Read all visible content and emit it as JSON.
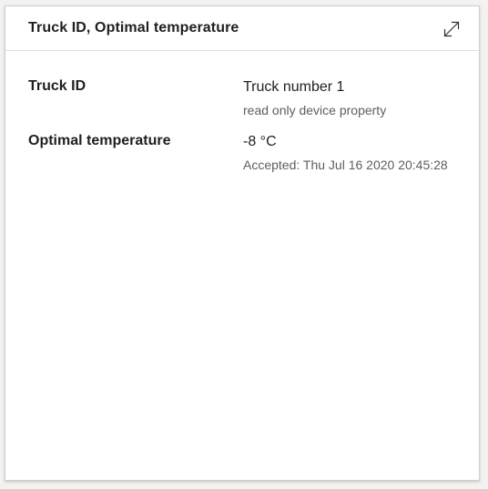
{
  "tile": {
    "title": "Truck ID, Optimal temperature",
    "expand_icon": "expand-icon"
  },
  "properties": [
    {
      "name": "Truck ID",
      "value": "Truck number 1",
      "sub": "read only device property"
    },
    {
      "name": "Optimal temperature",
      "value": "-8 °C",
      "sub": "Accepted: Thu Jul 16 2020 20:45:28"
    }
  ]
}
